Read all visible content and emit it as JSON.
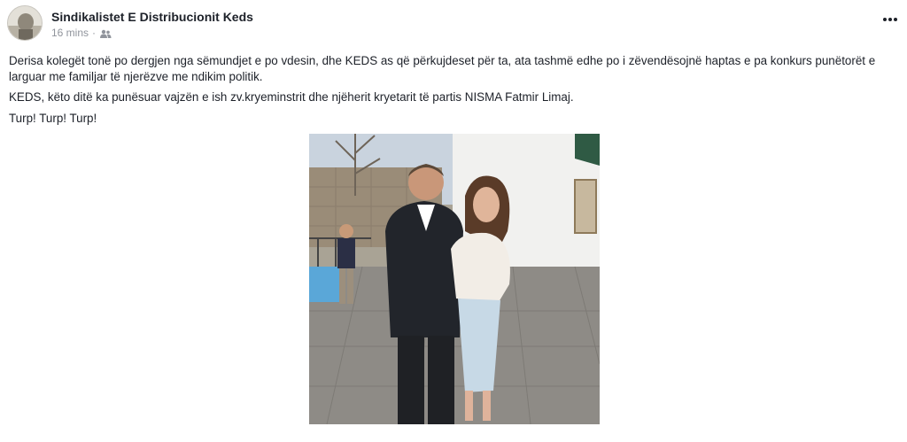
{
  "post": {
    "author": "Sindikalistet E Distribucionit Keds",
    "timestamp": "16 mins",
    "separator": "·",
    "audience_icon": "friends-icon",
    "more_icon": "more-horizontal-icon",
    "paragraphs": [
      "Derisa kolegët tonë po dergjen nga sëmundjet e po vdesin, dhe KEDS as që përkujdeset për ta, ata tashmë edhe po i zëvendësojnë haptas e pa konkurs punëtorët e larguar me familjar të njerëzve me ndikim politik.",
      "KEDS, këto ditë ka punësuar vajzën e ish zv.kryeminstrit dhe njëherit kryetarit të partis NISMA Fatmir Limaj.",
      "Turp! Turp! Turp!"
    ]
  },
  "colors": {
    "text": "#1d2129",
    "secondary_text": "#90949c",
    "background": "#ffffff"
  }
}
